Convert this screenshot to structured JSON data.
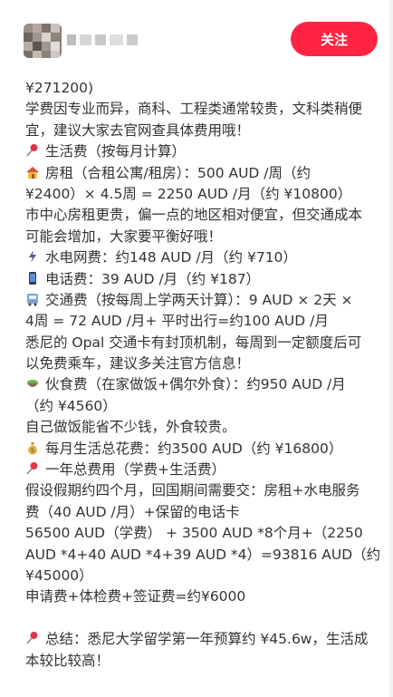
{
  "header": {
    "follow_label": "关注"
  },
  "lines": [
    "¥271200)",
    "学费因专业而异，商科、工程类通常较贵，文科类稍便",
    "宜，建议大家去官网查具体费用哦！",
    "生活费（按每月计算）",
    "房租（合租公寓/租房）：500 AUD /周（约",
    "¥2400）× 4.5周 = 2250 AUD /月（约 ¥10800）",
    "市中心房租更贵，偏一点的地区相对便宜，但交通成本",
    "可能会增加，大家要平衡好哦！",
    "水电网费：约148 AUD /月（约 ¥710）",
    "电话费：39 AUD /月（约 ¥187）",
    "交通费（按每周上学两天计算）：9 AUD × 2天 ×",
    "4周 = 72 AUD /月+ 平时出行=约100 AUD /月",
    "悉尼的 Opal 交通卡有封顶机制，每周到一定额度后可",
    "以免费乘车，建议多关注官方信息！",
    "伙食费（在家做饭+偶尔外食）：约950 AUD /月",
    "（约 ¥4560）",
    "自己做饭能省不少钱，外食较贵。",
    "每月生活总花费：约3500 AUD（约 ¥16800）",
    "一年总费用（学费+生活费）",
    "假设假期约四个月，回国期间需要交：房租+水电服务",
    "费（40 AUD /月）+保留的电话卡",
    "56500 AUD（学费）  + 3500 AUD *8个月+（2250",
    "AUD *4+40 AUD *4+39 AUD *4）=93816 AUD（约",
    "¥45000）",
    "申请费+体检费+签证费=约¥6000",
    "",
    "总结：悉尼大学留学第一年预算约 ¥45.6w，生活成",
    "本较比较高！"
  ],
  "icons": {
    "l3": "pushpin-icon",
    "l4": "house-icon",
    "l8": "lightning-icon",
    "l9": "phone-icon",
    "l10": "bus-icon",
    "l14": "food-bowl-icon",
    "l17": "money-bag-icon",
    "l18": "pushpin-icon",
    "l26": "pushpin-icon"
  },
  "colors": {
    "accent": "#ff2442",
    "text": "#333333"
  }
}
